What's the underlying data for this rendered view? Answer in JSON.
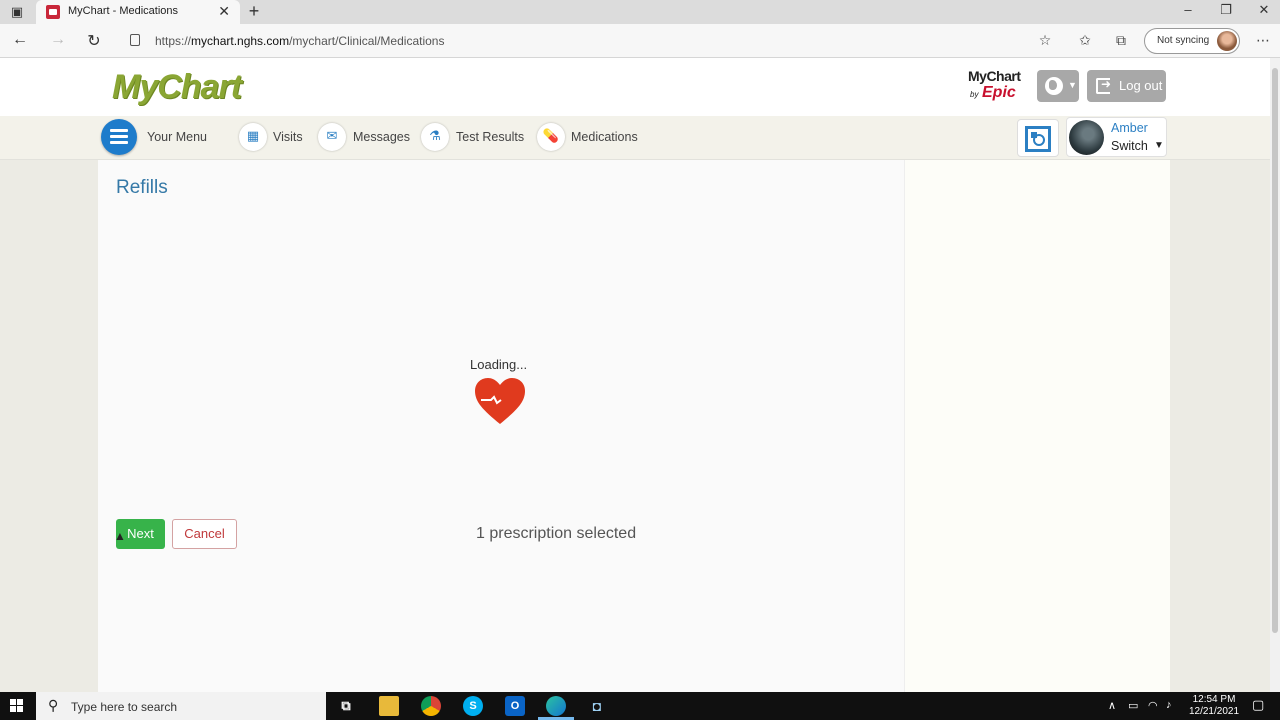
{
  "browser": {
    "tab_title": "MyChart - Medications",
    "url_prefix": "https://",
    "url_domain": "mychart.nghs.com",
    "url_path": "/mychart/Clinical/Medications",
    "sync_label": "Not syncing"
  },
  "header": {
    "logo": "MyChart",
    "epic_mychart": "MyChart",
    "epic_by": "by",
    "epic_name": "Epic",
    "logout_label": "Log out"
  },
  "menu": {
    "your_menu": "Your Menu",
    "items": [
      {
        "label": "Visits",
        "icon": "calendar-icon"
      },
      {
        "label": "Messages",
        "icon": "envelope-icon"
      },
      {
        "label": "Test Results",
        "icon": "flask-icon"
      },
      {
        "label": "Medications",
        "icon": "pill-icon"
      }
    ]
  },
  "user": {
    "name": "Amber",
    "switch_label": "Switch"
  },
  "main": {
    "title": "Refills",
    "loading_text": "Loading...",
    "next_label": "Next",
    "cancel_label": "Cancel",
    "selection_status": "1 prescription selected"
  },
  "taskbar": {
    "search_placeholder": "Type here to search",
    "time": "12:54 PM",
    "date": "12/21/2021"
  },
  "colors": {
    "brand_green": "#8aa634",
    "accent_blue": "#2b7fc3",
    "next_green": "#37b34a",
    "cancel_red": "#c0393b",
    "heart_red": "#e03a1e"
  }
}
